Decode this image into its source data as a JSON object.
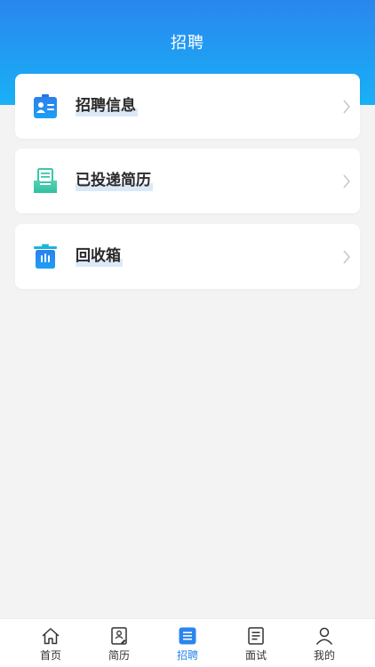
{
  "header": {
    "title": "招聘"
  },
  "menu": {
    "items": [
      {
        "label": "招聘信息",
        "icon": "id-card-icon"
      },
      {
        "label": "已投递简历",
        "icon": "tray-document-icon"
      },
      {
        "label": "回收箱",
        "icon": "trash-icon"
      }
    ]
  },
  "tabbar": {
    "active": "招聘",
    "tabs": [
      {
        "label": "首页",
        "icon": "home-icon"
      },
      {
        "label": "简历",
        "icon": "resume-icon"
      },
      {
        "label": "招聘",
        "icon": "list-icon"
      },
      {
        "label": "面试",
        "icon": "document-icon"
      },
      {
        "label": "我的",
        "icon": "user-icon"
      }
    ]
  },
  "colors": {
    "header_top": "#2a86ee",
    "header_bottom": "#1ab0f6",
    "accent": "#2a86ee",
    "teal": "#3cc6a8",
    "background": "#f3f3f3"
  }
}
